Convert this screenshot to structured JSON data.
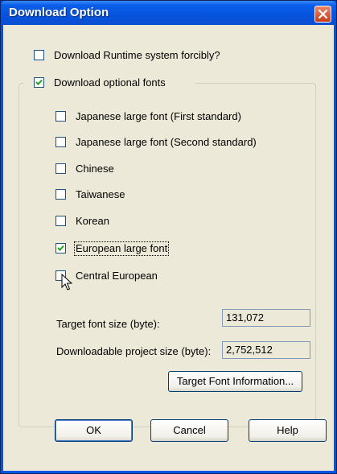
{
  "window": {
    "title": "Download Option"
  },
  "runtime": {
    "label": "Download Runtime system forcibly?",
    "checked": false
  },
  "fonts_group": {
    "label": "Download optional fonts",
    "checked": true
  },
  "fonts": [
    {
      "label": "Japanese large font (First standard)",
      "checked": false
    },
    {
      "label": "Japanese large font (Second standard)",
      "checked": false
    },
    {
      "label": "Chinese",
      "checked": false
    },
    {
      "label": "Taiwanese",
      "checked": false
    },
    {
      "label": "Korean",
      "checked": false
    },
    {
      "label": "European large font",
      "checked": true
    },
    {
      "label": "Central European",
      "checked": false
    }
  ],
  "target_font_size": {
    "label": "Target font size (byte):",
    "value": "131,072"
  },
  "project_size": {
    "label": "Downloadable project size (byte):",
    "value": "2,752,512"
  },
  "buttons": {
    "font_info": "Target Font Information...",
    "ok": "OK",
    "cancel": "Cancel",
    "help": "Help"
  }
}
